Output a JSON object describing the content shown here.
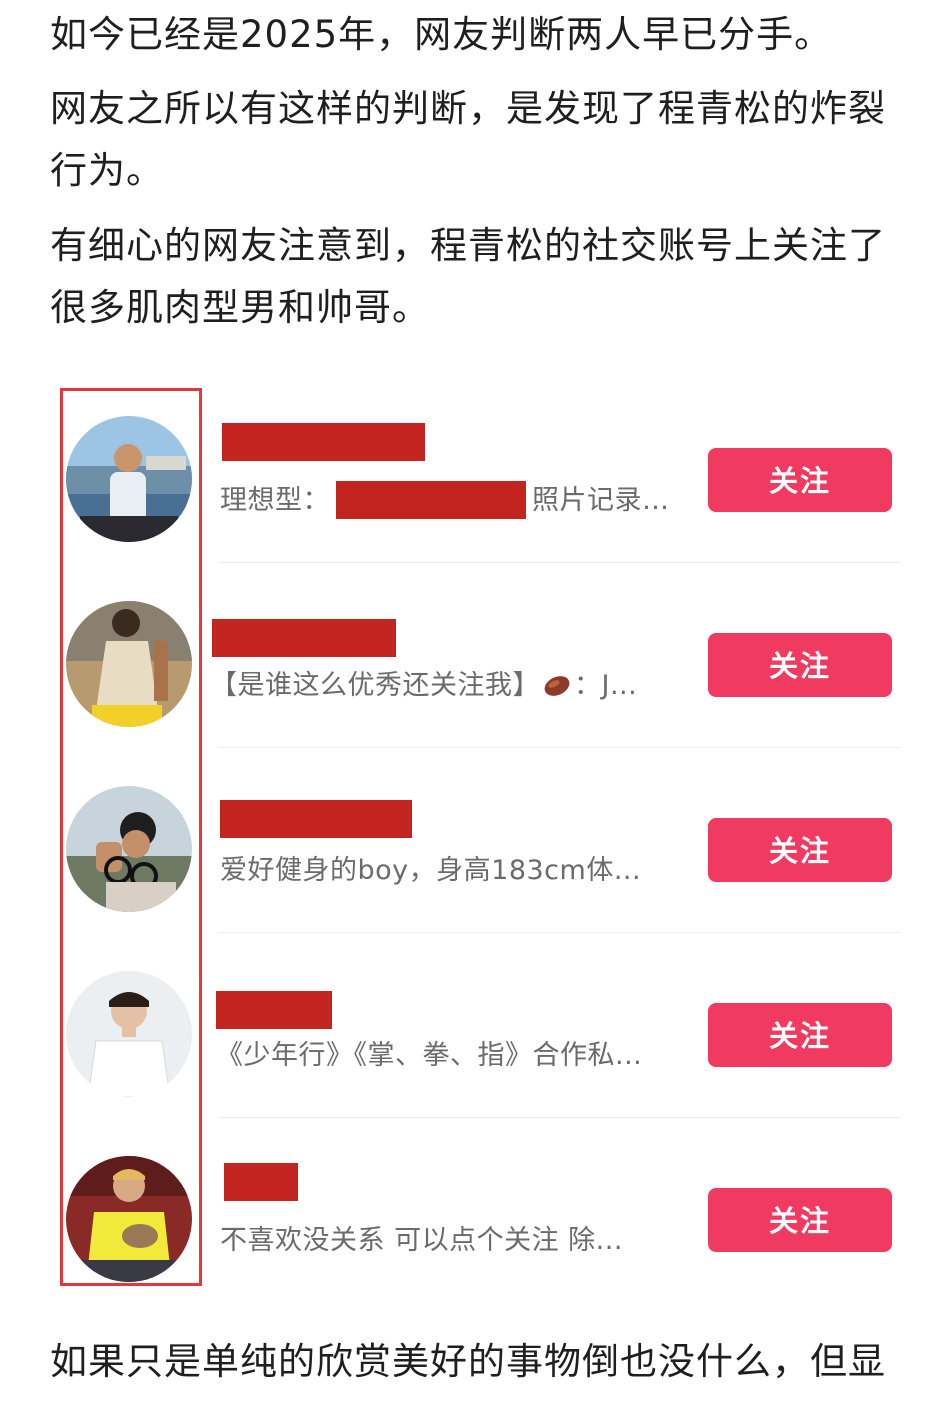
{
  "article": {
    "paragraph_1": "如今已经是2025年，网友判断两人早已分手。",
    "paragraph_2": "网友之所以有这样的判断，是发现了程青松的炸裂行为。",
    "paragraph_3": "有细心的网友注意到，程青松的社交账号上关注了很多肌肉型男和帅哥。",
    "paragraph_4": "如果只是单纯的欣赏美好的事物倒也没什么，但显"
  },
  "follow_list": {
    "items": [
      {
        "avatar_icon": "profile-photo-man-on-boat",
        "bio_prefix": "理想型：",
        "bio_suffix": "照片记录…",
        "follow_label": "关注"
      },
      {
        "avatar_icon": "profile-photo-man-sunlight",
        "bio_prefix": "【是谁这么优秀还关注我】",
        "bio_emoji": "sweet-potato-icon",
        "bio_suffix": "：J...",
        "follow_label": "关注"
      },
      {
        "avatar_icon": "profile-photo-man-glasses",
        "bio_prefix": "爱好健身的boy，身高183cm体...",
        "follow_label": "关注"
      },
      {
        "avatar_icon": "profile-photo-young-man-white-shirt",
        "bio_prefix": "《少年行》《掌、拳、指》合作私...",
        "follow_label": "关注"
      },
      {
        "avatar_icon": "profile-photo-man-yellow-shirt",
        "bio_prefix": "不喜欢没关系 可以点个关注 除...",
        "follow_label": "关注"
      }
    ]
  },
  "colors": {
    "follow_button": "#f03a5f",
    "redaction": "#c4241f",
    "highlight_frame": "#e0383c",
    "bio_text": "#6b6b6b"
  }
}
